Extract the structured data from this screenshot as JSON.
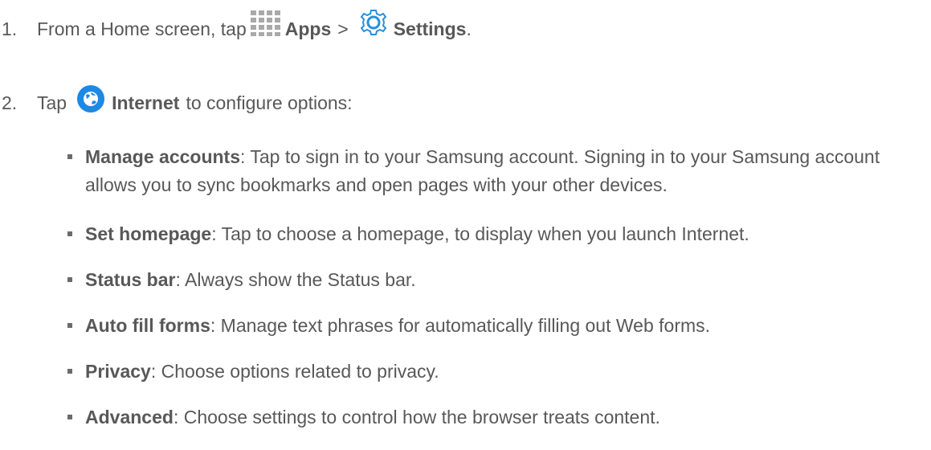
{
  "steps": [
    {
      "number": "1.",
      "prefix": "From a Home screen, tap",
      "apps_label": "Apps",
      "separator": ">",
      "settings_label": "Settings",
      "suffix": ".",
      "icons": [
        "apps-grid-icon",
        "settings-gear-icon"
      ]
    },
    {
      "number": "2.",
      "prefix": "Tap",
      "internet_label": "Internet",
      "suffix": "to configure options:",
      "icons": [
        "internet-globe-icon"
      ]
    }
  ],
  "options": [
    {
      "term": "Manage accounts",
      "description": ": Tap to sign in to your Samsung account. Signing in to your Samsung account allows you to sync bookmarks and open pages with your other devices."
    },
    {
      "term": "Set homepage",
      "description": ": Tap to choose a homepage, to display when you launch Internet."
    },
    {
      "term": "Status bar",
      "description": ": Always show the Status bar."
    },
    {
      "term": "Auto fill forms",
      "description": ": Manage text phrases for automatically filling out Web forms."
    },
    {
      "term": "Privacy",
      "description": ": Choose options related to privacy."
    },
    {
      "term": "Advanced",
      "description": ": Choose settings to control how the browser treats content."
    }
  ],
  "colors": {
    "text": "#585858",
    "globe_blue": "#1e88e5",
    "gear_blue": "#2a8fd8",
    "apps_grid": "#a9a9a9"
  }
}
